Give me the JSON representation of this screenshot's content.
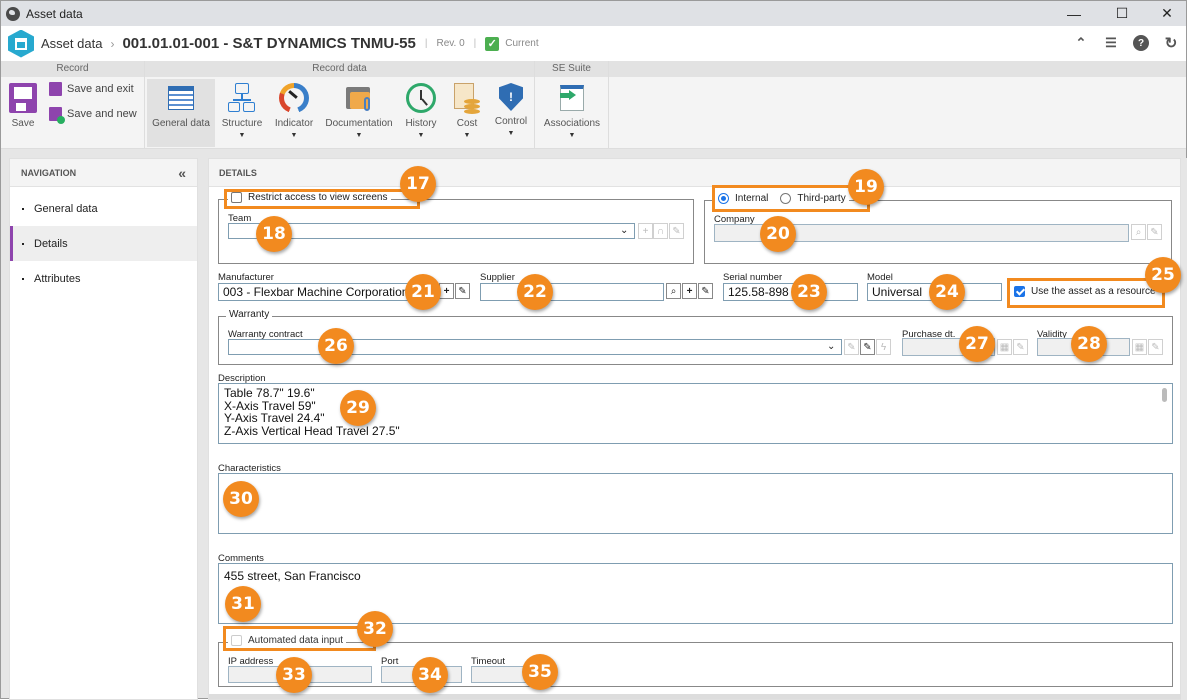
{
  "window": {
    "title": "Asset data",
    "controls": {
      "minimize": "—",
      "maximize": "☐",
      "close": "✕"
    }
  },
  "header": {
    "breadcrumb_root": "Asset data",
    "breadcrumb_separator": "›",
    "record_title": "001.01.01-001 - S&T DYNAMICS TNMU-55",
    "revision": "Rev. 0",
    "status": "Current",
    "status_color": "#4caf50",
    "actions": [
      "collapse-up-icon",
      "list-icon",
      "help-icon",
      "refresh-icon"
    ]
  },
  "ribbon": {
    "groups": [
      {
        "label": "Record"
      },
      {
        "label": "Record data"
      },
      {
        "label": "SE Suite"
      }
    ],
    "save": "Save",
    "save_and_exit": "Save and exit",
    "save_and_new": "Save and new",
    "buttons": [
      {
        "label": "General data",
        "icon": "form-icon",
        "active": true
      },
      {
        "label": "Structure",
        "icon": "structure-icon",
        "dropdown": true
      },
      {
        "label": "Indicator",
        "icon": "gauge-icon",
        "dropdown": true
      },
      {
        "label": "Documentation",
        "icon": "folder-clip-icon",
        "dropdown": true
      },
      {
        "label": "History",
        "icon": "history-clock-icon",
        "dropdown": true
      },
      {
        "label": "Cost",
        "icon": "cost-icon",
        "dropdown": true
      },
      {
        "label": "Control",
        "icon": "shield-warning-icon",
        "dropdown": true
      },
      {
        "label": "Associations",
        "icon": "associations-icon",
        "dropdown": true
      }
    ]
  },
  "navigation": {
    "title": "NAVIGATION",
    "collapse_icon": "«",
    "items": [
      {
        "label": "General data",
        "active": false
      },
      {
        "label": "Details",
        "active": true
      },
      {
        "label": "Attributes",
        "active": false
      }
    ],
    "accent": "#8e44ad"
  },
  "details": {
    "title": "DETAILS",
    "restrict_access": {
      "label": "Restrict access to view screens",
      "checked": false
    },
    "team": {
      "label": "Team",
      "value": ""
    },
    "ownership": {
      "options": [
        "Internal",
        "Third-party"
      ],
      "selected": "Internal"
    },
    "company": {
      "label": "Company",
      "value": ""
    },
    "manufacturer": {
      "label": "Manufacturer",
      "value": "003 - Flexbar Machine Corporation"
    },
    "supplier": {
      "label": "Supplier",
      "value": ""
    },
    "serial_number": {
      "label": "Serial number",
      "value": "125.58-898"
    },
    "model": {
      "label": "Model",
      "value": "Universal"
    },
    "use_as_resource": {
      "label": "Use the asset as a resource",
      "checked": true
    },
    "warranty": {
      "legend": "Warranty",
      "contract_label": "Warranty contract",
      "contract_value": "",
      "purchase_label": "Purchase dt.",
      "purchase_value": "",
      "validity_label": "Validity",
      "validity_value": ""
    },
    "description": {
      "label": "Description",
      "lines": [
        "Table 78.7\" 19.6\"",
        "X-Axis Travel 59\"",
        "Y-Axis Travel 24.4\"",
        "Z-Axis Vertical Head Travel 27.5\""
      ]
    },
    "characteristics": {
      "label": "Characteristics",
      "value": ""
    },
    "comments": {
      "label": "Comments",
      "value": "455 street, San Francisco"
    },
    "automated_input": {
      "label": "Automated data input",
      "checked": false
    },
    "ip_address": {
      "label": "IP address",
      "value": ""
    },
    "port": {
      "label": "Port",
      "value": ""
    },
    "timeout": {
      "label": "Timeout",
      "value": ""
    }
  },
  "callouts": [
    "17",
    "18",
    "19",
    "20",
    "21",
    "22",
    "23",
    "24",
    "25",
    "26",
    "27",
    "28",
    "29",
    "30",
    "31",
    "32",
    "33",
    "34",
    "35"
  ],
  "callout_color": "#f28a1f"
}
